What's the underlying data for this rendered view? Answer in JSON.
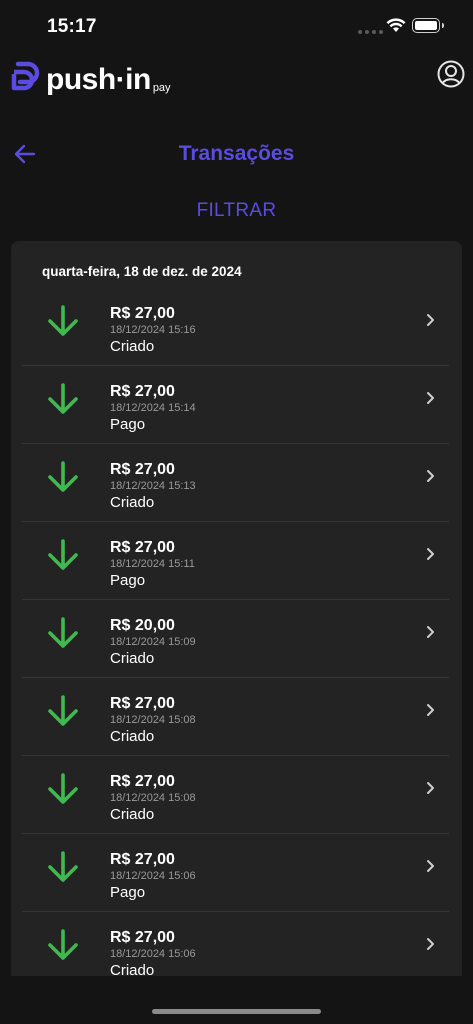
{
  "status_bar": {
    "time": "15:17"
  },
  "app": {
    "brand_name": "push·in",
    "brand_suffix": "pay"
  },
  "colors": {
    "accent": "#5a4cde",
    "incoming": "#3fb950",
    "card": "#232323",
    "background": "#141414"
  },
  "page": {
    "title": "Transações",
    "filter_label": "FILTRAR"
  },
  "transactions": {
    "date_label": "quarta-feira, 18 de dez. de 2024",
    "icon": "arrow-down-icon",
    "items": [
      {
        "amount": "R$ 27,00",
        "datetime": "18/12/2024 15:16",
        "status": "Criado"
      },
      {
        "amount": "R$ 27,00",
        "datetime": "18/12/2024 15:14",
        "status": "Pago"
      },
      {
        "amount": "R$ 27,00",
        "datetime": "18/12/2024 15:13",
        "status": "Criado"
      },
      {
        "amount": "R$ 27,00",
        "datetime": "18/12/2024 15:11",
        "status": "Pago"
      },
      {
        "amount": "R$ 20,00",
        "datetime": "18/12/2024 15:09",
        "status": "Criado"
      },
      {
        "amount": "R$ 27,00",
        "datetime": "18/12/2024 15:08",
        "status": "Criado"
      },
      {
        "amount": "R$ 27,00",
        "datetime": "18/12/2024 15:08",
        "status": "Criado"
      },
      {
        "amount": "R$ 27,00",
        "datetime": "18/12/2024 15:06",
        "status": "Pago"
      },
      {
        "amount": "R$ 27,00",
        "datetime": "18/12/2024 15:06",
        "status": "Criado"
      }
    ]
  }
}
